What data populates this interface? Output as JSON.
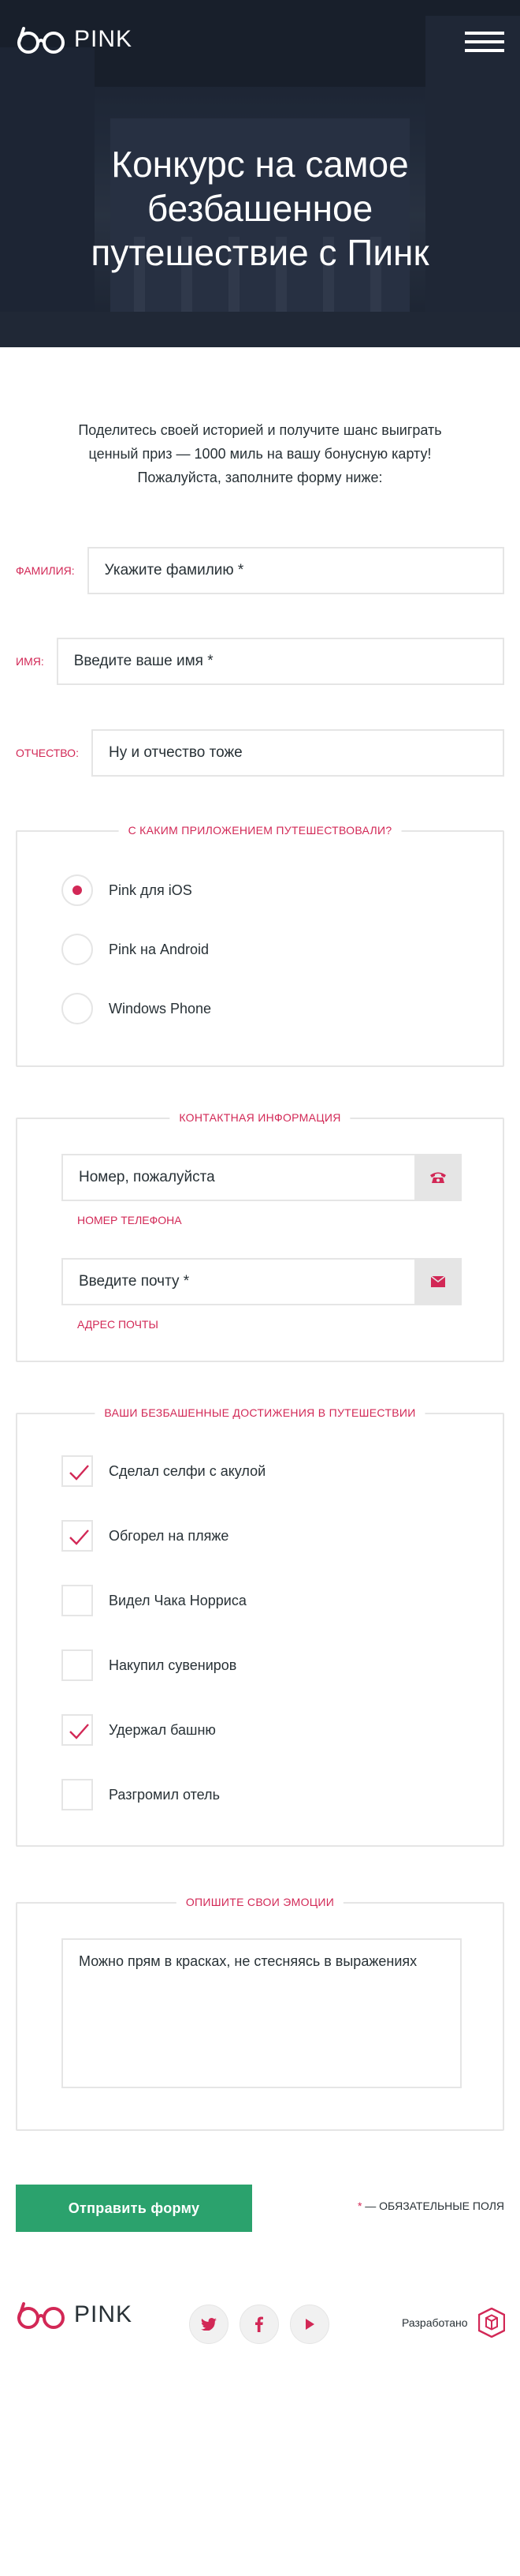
{
  "header": {
    "logo_text": "PINK",
    "icons": {
      "logo": "glasses-logo-icon",
      "menu": "hamburger-menu-icon"
    }
  },
  "hero": {
    "title_line1": "Конкурс на самое",
    "title_line2": "безбашенное",
    "title_line3": "путешествие с Пинк"
  },
  "intro": {
    "line1": "Поделитесь своей историей и получите шанс выиграть",
    "line2": "ценный приз — 1000 миль на вашу бонусную карту!",
    "line3": "Пожалуйста, заполните форму ниже:"
  },
  "name_fields": [
    {
      "label": "Фамилия:",
      "placeholder": "Укажите фамилию *"
    },
    {
      "label": "Имя:",
      "placeholder": "Введите ваше имя *"
    },
    {
      "label": "Отчество:",
      "placeholder": "Ну и отчество тоже"
    }
  ],
  "app_section": {
    "legend": "С каким приложением путешествовали?",
    "options": [
      {
        "label": "Pink для iOS",
        "checked": true
      },
      {
        "label": "Pink на Android",
        "checked": false
      },
      {
        "label": "Windows Phone",
        "checked": false
      }
    ]
  },
  "contact_section": {
    "legend": "Контактная информация",
    "phone": {
      "placeholder": "Номер, пожалуйста",
      "label": "Номер телефона",
      "icon": "phone-icon"
    },
    "email": {
      "placeholder": "Введите почту *",
      "label": "Адрес почты",
      "icon": "envelope-icon"
    }
  },
  "achievements_section": {
    "legend": "Ваши безбашенные достижения в путешествии",
    "items": [
      {
        "label": "Сделал селфи с акулой",
        "checked": true
      },
      {
        "label": "Обгорел на пляже",
        "checked": true
      },
      {
        "label": "Видел Чака Норриса",
        "checked": false
      },
      {
        "label": "Накупил сувениров",
        "checked": false
      },
      {
        "label": "Удержал башню",
        "checked": true
      },
      {
        "label": "Разгромил отель",
        "checked": false
      }
    ]
  },
  "emotions_section": {
    "legend": "Опишите свои эмоции",
    "placeholder": "Можно прям в красках, не стесняясь в выражениях"
  },
  "submit": {
    "label": "Отправить форму",
    "required_star": "*",
    "required_note": " — обязательные поля"
  },
  "footer": {
    "logo_text": "PINK",
    "social_icons": [
      "twitter-icon",
      "facebook-icon",
      "youtube-icon"
    ],
    "dev_label": "Разработано",
    "dev_logo_icon": "htmlacademy-logo-icon"
  },
  "colors": {
    "accent": "#d22856",
    "button": "#2ba26d",
    "text": "#283136",
    "border": "#e5e5e5",
    "hero_bg": "#2b3649"
  }
}
